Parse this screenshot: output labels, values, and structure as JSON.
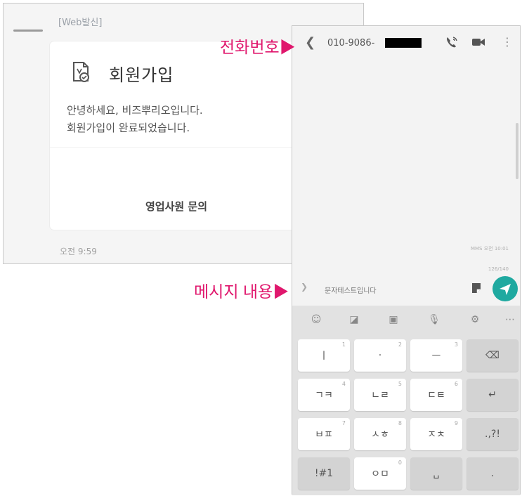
{
  "message_card": {
    "sender_label": "[Web발신]",
    "title": "회원가입",
    "body": "안녕하세요, 비즈뿌리오입니다.\n회원가입이 완료되었습니다.",
    "button_label": "영업사원 문의",
    "time": "오전 9:59"
  },
  "phone": {
    "back_glyph": "❮",
    "number": "010-9086-",
    "more_glyph": "⋮",
    "sent_status": "MMS 오전 10:01",
    "char_count": "126/140",
    "input_value": "문자테스트입니다"
  },
  "keyboard": {
    "toolbar": [
      "emoji-icon",
      "sticker-icon",
      "gif-icon",
      "mic-icon",
      "settings-icon",
      "more-icon"
    ],
    "rows": [
      [
        {
          "label": "ㅣ",
          "num": "1"
        },
        {
          "label": "·",
          "num": "2"
        },
        {
          "label": "ㅡ",
          "num": "3"
        },
        {
          "label": "⌫",
          "fn": true
        }
      ],
      [
        {
          "label": "ㄱㅋ",
          "num": "4"
        },
        {
          "label": "ㄴㄹ",
          "num": "5"
        },
        {
          "label": "ㄷㅌ",
          "num": "6"
        },
        {
          "label": "↵",
          "fn": true
        }
      ],
      [
        {
          "label": "ㅂㅍ",
          "num": "7"
        },
        {
          "label": "ㅅㅎ",
          "num": "8"
        },
        {
          "label": "ㅈㅊ",
          "num": "9"
        },
        {
          "label": ".,?!",
          "fn": true
        }
      ],
      [
        {
          "label": "!#1",
          "fn": true
        },
        {
          "label": "ㅇㅁ",
          "num": "0"
        },
        {
          "label": "␣",
          "fn": true
        },
        {
          "label": ".",
          "fn": true
        }
      ]
    ]
  },
  "annotations": {
    "phone_number": "전화번호▶",
    "message_content": "메시지 내용▶"
  },
  "colors": {
    "accent_annotation": "#e0176d",
    "send_button": "#1fa9a0"
  }
}
